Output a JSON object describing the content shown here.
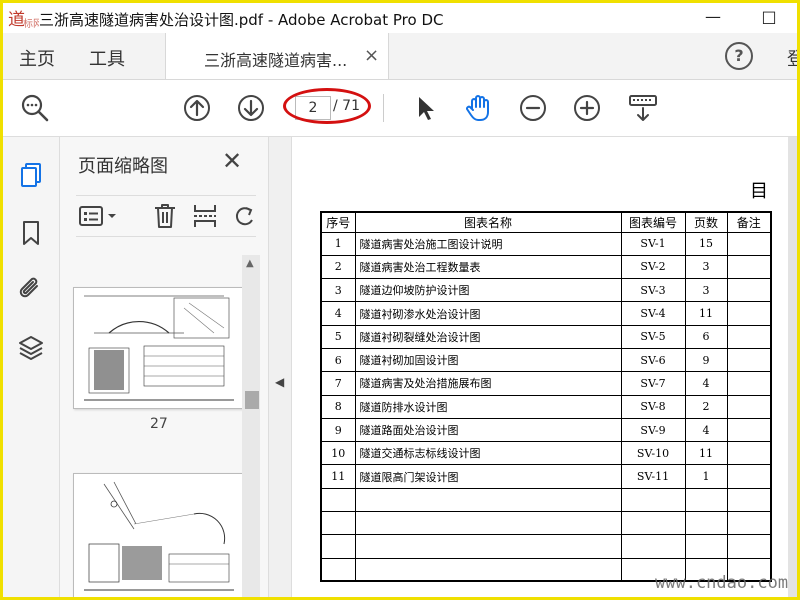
{
  "window": {
    "title": "三浙高速隧道病害处治设计图.pdf - Adobe Acrobat Pro DC",
    "minimize_glyph": "—",
    "maximize_glyph": "□"
  },
  "tabs": {
    "home": "主页",
    "tools": "工具",
    "document": "三浙高速隧道病害...",
    "close_glyph": "×",
    "help_glyph": "?",
    "signin_cut": "登"
  },
  "toolbar": {
    "current_page": "2",
    "total_pages": "/ 71"
  },
  "thumbnails": {
    "panel_title": "页面缩略图",
    "close_glyph": "✕",
    "first_page_label": "27"
  },
  "document": {
    "heading": "目",
    "columns": [
      "序号",
      "图表名称",
      "图表编号",
      "页数",
      "备注"
    ],
    "rows": [
      {
        "no": "1",
        "name": "隧道病害处治施工图设计说明",
        "code": "SV-1",
        "pages": "15",
        "remark": ""
      },
      {
        "no": "2",
        "name": "隧道病害处治工程数量表",
        "code": "SV-2",
        "pages": "3",
        "remark": ""
      },
      {
        "no": "3",
        "name": "隧道边仰坡防护设计图",
        "code": "SV-3",
        "pages": "3",
        "remark": ""
      },
      {
        "no": "4",
        "name": "隧道衬砌渗水处治设计图",
        "code": "SV-4",
        "pages": "11",
        "remark": ""
      },
      {
        "no": "5",
        "name": "隧道衬砌裂缝处治设计图",
        "code": "SV-5",
        "pages": "6",
        "remark": ""
      },
      {
        "no": "6",
        "name": "隧道衬砌加固设计图",
        "code": "SV-6",
        "pages": "9",
        "remark": ""
      },
      {
        "no": "7",
        "name": "隧道病害及处治措施展布图",
        "code": "SV-7",
        "pages": "4",
        "remark": ""
      },
      {
        "no": "8",
        "name": "隧道防排水设计图",
        "code": "SV-8",
        "pages": "2",
        "remark": ""
      },
      {
        "no": "9",
        "name": "隧道路面处治设计图",
        "code": "SV-9",
        "pages": "4",
        "remark": ""
      },
      {
        "no": "10",
        "name": "隧道交通标志标线设计图",
        "code": "SV-10",
        "pages": "11",
        "remark": ""
      },
      {
        "no": "11",
        "name": "隧道限高门架设计图",
        "code": "SV-11",
        "pages": "1",
        "remark": ""
      }
    ],
    "empty_rows": 4
  },
  "watermark": {
    "text": "www.cndao.com",
    "logo_text": "道标网"
  },
  "colors": {
    "frame_border": "#f0e000",
    "annotation_ellipse": "#d41010",
    "hand_tool_active": "#1473e6",
    "rail_active_icon": "#1473e6"
  },
  "icons": {
    "toolbar": [
      "search-zoom-icon",
      "page-up-icon",
      "page-down-icon",
      "select-arrow-icon",
      "hand-tool-icon",
      "zoom-out-icon",
      "zoom-in-icon",
      "keyboard-scroll-icon"
    ],
    "rail": [
      "page-thumbnails-icon",
      "bookmark-icon",
      "attachment-icon",
      "layers-icon"
    ],
    "panel": [
      "thumbnail-options-icon",
      "delete-icon",
      "insert-pages-icon",
      "rotate-icon"
    ]
  }
}
